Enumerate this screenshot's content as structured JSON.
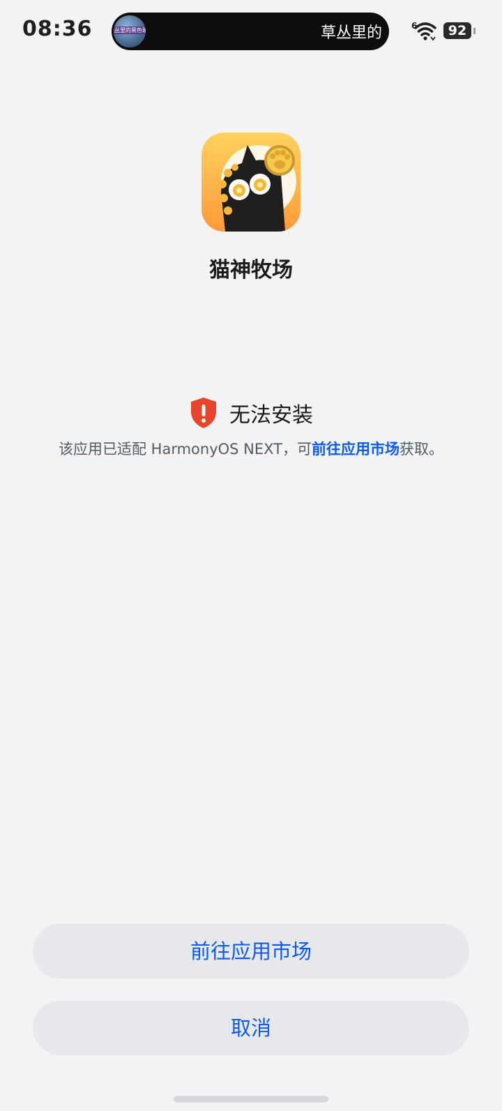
{
  "status_bar": {
    "time": "08:36",
    "island_thumbnail_caption": "丛里的黑色玻",
    "island_text": "草丛里的",
    "network_badge": "6",
    "battery_level": "92",
    "wifi_icon": "wifi-icon",
    "battery_icon": "battery-icon"
  },
  "app": {
    "name": "猫神牧场",
    "icon": "app-icon-black-cat",
    "icon_background_colors": [
      "#ffcb5c",
      "#ff9f3a"
    ]
  },
  "warning": {
    "icon": "shield-alert-icon",
    "icon_color": "#e8452c",
    "title": "无法安装",
    "desc_prefix": "该应用已适配 HarmonyOS NEXT，可",
    "desc_link": "前往应用市场",
    "desc_suffix": "获取。"
  },
  "buttons": {
    "go_market": "前往应用市场",
    "cancel": "取消"
  },
  "colors": {
    "accent": "#0a59f7",
    "background": "#f1f3f5",
    "button_bg": "#e6e8eb"
  }
}
